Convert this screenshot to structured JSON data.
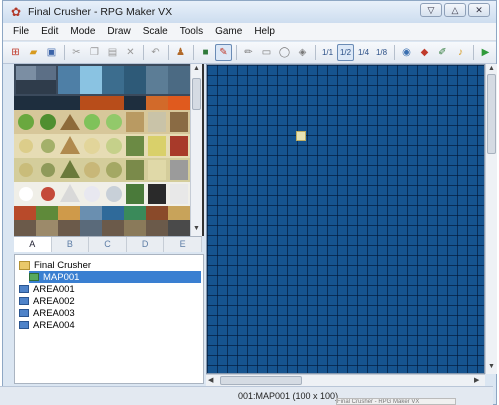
{
  "window": {
    "title": "Final Crusher - RPG Maker VX",
    "icon": "rpg-maker-icon",
    "controls": [
      "minimize-icon",
      "maximize-icon",
      "close-icon"
    ]
  },
  "menu": {
    "items": [
      "File",
      "Edit",
      "Mode",
      "Draw",
      "Scale",
      "Tools",
      "Game",
      "Help"
    ]
  },
  "toolbar": {
    "buttons": [
      "new-project-icon",
      "open-project-icon",
      "save-project-icon",
      "cut-icon",
      "copy-icon",
      "paste-icon",
      "delete-icon",
      "undo-icon",
      "map-mode-icon",
      "event-mode-icon",
      "pencil-icon",
      "rectangle-icon",
      "ellipse-icon",
      "fill-icon",
      "scale-1-1-icon",
      "scale-1-2-icon",
      "scale-1-4-icon",
      "scale-1-8-icon",
      "database-icon",
      "material-manager-icon",
      "script-editor-icon",
      "sound-test-icon",
      "play-test-icon"
    ],
    "scale_labels": [
      "1/1",
      "1/2",
      "1/4",
      "1/8"
    ]
  },
  "tileset": {
    "tabs": [
      "A",
      "B",
      "C",
      "D",
      "E"
    ],
    "active_tab": "A"
  },
  "map_tree": {
    "project": "Final Crusher",
    "maps": [
      "MAP001",
      "AREA001",
      "AREA002",
      "AREA003",
      "AREA004"
    ],
    "selected": "MAP001"
  },
  "status": {
    "map_info": "001:MAP001 (100 x 100)"
  },
  "taskbar": {
    "label": "Final Crusher - RPG Maker VX"
  },
  "colors": {
    "map_background": "#16548f",
    "selection": "#3a7fd1",
    "window_frame": "#dbe6f2"
  }
}
